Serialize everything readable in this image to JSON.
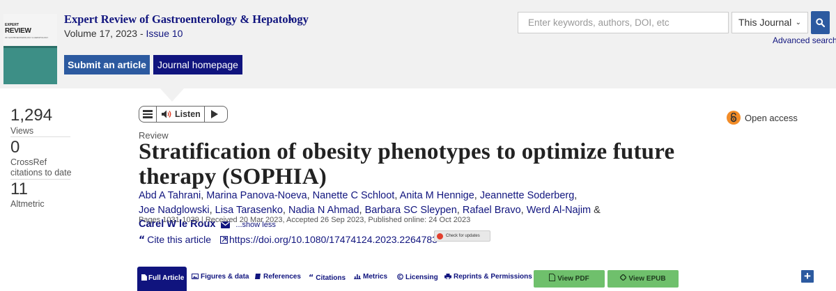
{
  "header": {
    "cover_art": {
      "line1": "EXPERT",
      "line2": "REVIEW",
      "line3": "OF GASTROENTEROLOGY & HEPATOLOGY"
    },
    "journal_title": "Expert Review of Gastroenterology & Hepatology",
    "journal_chevron": "›",
    "volume_text": "Volume 17, 2023 - ",
    "issue_text": "Issue 10",
    "submit_label": "Submit an article",
    "homepage_label": "Journal homepage"
  },
  "search": {
    "placeholder": "Enter keywords, authors, DOI, etc",
    "scope_selected": "This Journal",
    "scope_chevron": "⌄",
    "advanced_label": "Advanced search"
  },
  "metrics": [
    {
      "value": "1,294",
      "label": "Views"
    },
    {
      "value": "0",
      "label": "CrossRef citations to date"
    },
    {
      "value": "11",
      "label": "Altmetric"
    }
  ],
  "listen": {
    "label": "Listen"
  },
  "open_access": {
    "label": "Open access"
  },
  "article": {
    "type": "Review",
    "title": "Stratification of obesity phenotypes to optimize future therapy (SOPHIA)",
    "authors": [
      "Abd A Tahrani",
      "Marina Panova-Noeva",
      "Nanette C Schloot",
      "Anita M Hennige",
      "Jeannette Soderberg",
      "Joe Nadglowski",
      "Lisa Tarasenko",
      "Nadia N Ahmad",
      "Barbara SC Sleypen",
      "Rafael Bravo",
      "Werd Al-Najim"
    ],
    "corresponding_author": "Carel W le Roux",
    "ampersand": "&",
    "show_less": "...show less",
    "pub_info": "Pages 1031-1039 | Received 20 Mar 2023, Accepted 26 Sep 2023, Published online: 24 Oct 2023",
    "cite_label": "Cite this article",
    "doi": "https://doi.org/10.1080/17474124.2023.2264783",
    "check_updates": "Check for updates"
  },
  "tabs": {
    "full_article": "Full Article",
    "figures": "Figures & data",
    "references": "References",
    "citations": "Citations",
    "metrics": "Metrics",
    "licensing": "Licensing",
    "reprints": "Reprints & Permissions",
    "view_pdf": "View PDF",
    "view_epub": "View EPUB"
  },
  "colors": {
    "navy": "#10147e",
    "blue": "#2c5aa0",
    "green": "#6fc06c",
    "orange": "#f28c28",
    "header_bg": "#f1f1f1"
  }
}
